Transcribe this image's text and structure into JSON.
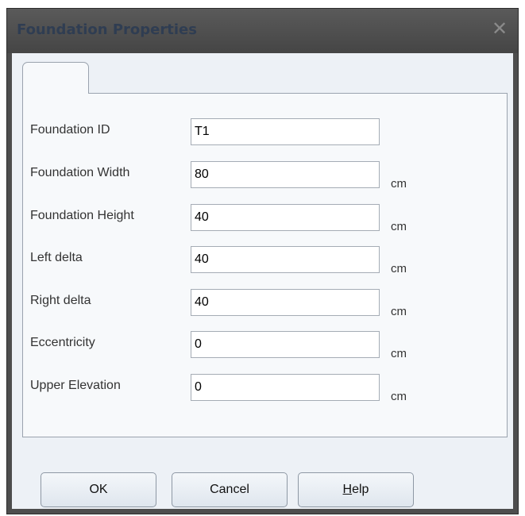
{
  "window": {
    "title": "Foundation Properties",
    "close_glyph": "✕"
  },
  "tab": {
    "label": ""
  },
  "fields": [
    {
      "label": "Foundation ID",
      "value": "T1",
      "unit": ""
    },
    {
      "label": "Foundation Width",
      "value": "80",
      "unit": "cm"
    },
    {
      "label": "Foundation Height",
      "value": "40",
      "unit": "cm"
    },
    {
      "label": "Left delta",
      "value": "40",
      "unit": "cm"
    },
    {
      "label": "Right delta",
      "value": "40",
      "unit": "cm"
    },
    {
      "label": "Eccentricity",
      "value": "0",
      "unit": "cm"
    },
    {
      "label": "Upper Elevation",
      "value": "0",
      "unit": "cm"
    }
  ],
  "buttons": {
    "ok": "OK",
    "cancel": "Cancel",
    "help_mnemonic": "H",
    "help_rest": "elp"
  },
  "colors": {
    "titlebar": "#4d4d4d",
    "title_text": "#2f3d52",
    "client_bg": "#edf1f6"
  }
}
